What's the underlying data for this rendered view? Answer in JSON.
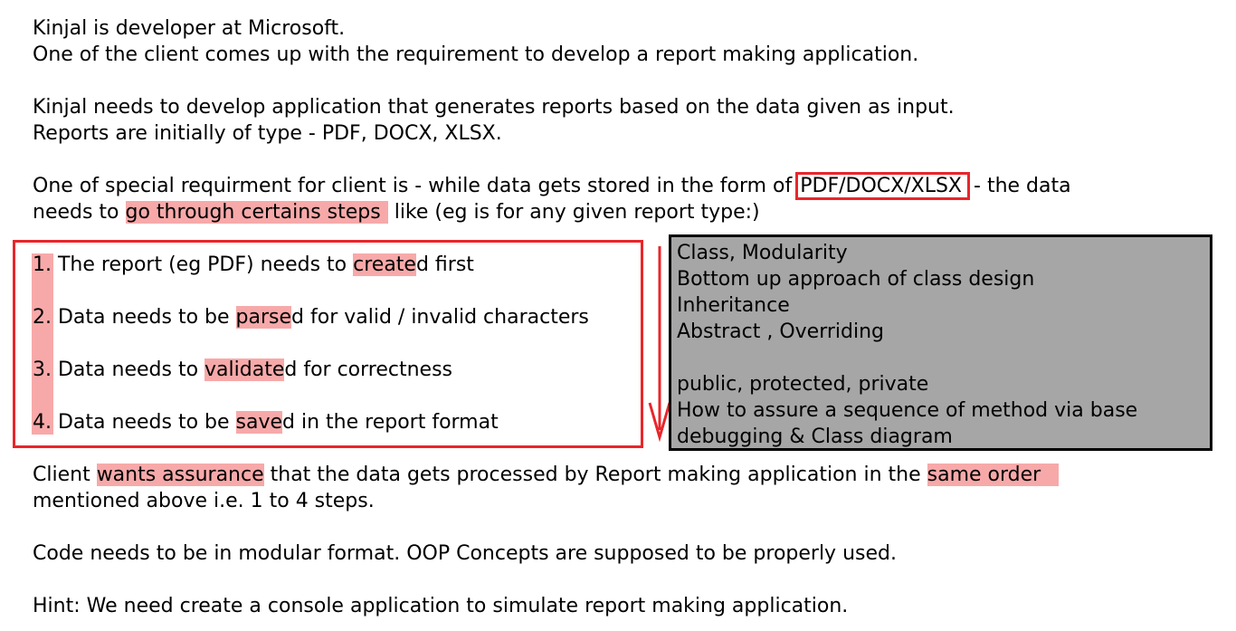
{
  "intro": {
    "line1": "Kinjal is developer at Microsoft.",
    "line2": "One of the client comes up with the requirement to develop a report making application.",
    "line3": "Kinjal needs to develop application that generates reports based on the data given as input.",
    "line4": "Reports are initially of type - PDF, DOCX, XLSX."
  },
  "special": {
    "before": "One of special requirment for client is - while data gets stored in the form of ",
    "formats": "PDF/DOCX/XLSX",
    "after": " - the data",
    "line2_before": "needs to ",
    "steps_phrase": "go through certains steps",
    "line2_after": " like (eg is for any given report type:)"
  },
  "steps": [
    {
      "num": "1.",
      "before": " The report (eg PDF) needs to ",
      "hl": "create",
      "after": "d first"
    },
    {
      "num": "2.",
      "before": " Data needs to be ",
      "hl": "parse",
      "after": "d for valid / invalid characters"
    },
    {
      "num": "3.",
      "before": " Data needs to ",
      "hl": "validate",
      "after": "d for correctness"
    },
    {
      "num": "4.",
      "before": " Data needs to be ",
      "hl": "save",
      "after": "d in the report format"
    }
  ],
  "concepts": [
    "Class, Modularity",
    "Bottom up approach of class design",
    "Inheritance",
    "Abstract , Overriding",
    "",
    "public, protected, private",
    "How to assure a sequence of method via base",
    "debugging & Class diagram"
  ],
  "assurance": {
    "before": "Client ",
    "hl1": "wants assurance",
    "middle": " that the data gets processed by Report making application in the ",
    "hl2": "same order",
    "line2": "mentioned above i.e. 1 to 4 steps."
  },
  "modular": "Code needs to be in modular format. OOP Concepts are supposed to be properly used.",
  "hint": "Hint: We need create a console application to simulate report making application.",
  "colors": {
    "highlight": "#f7a9a9",
    "red_outline": "#e8262b",
    "concept_bg": "#a6a6a6"
  }
}
